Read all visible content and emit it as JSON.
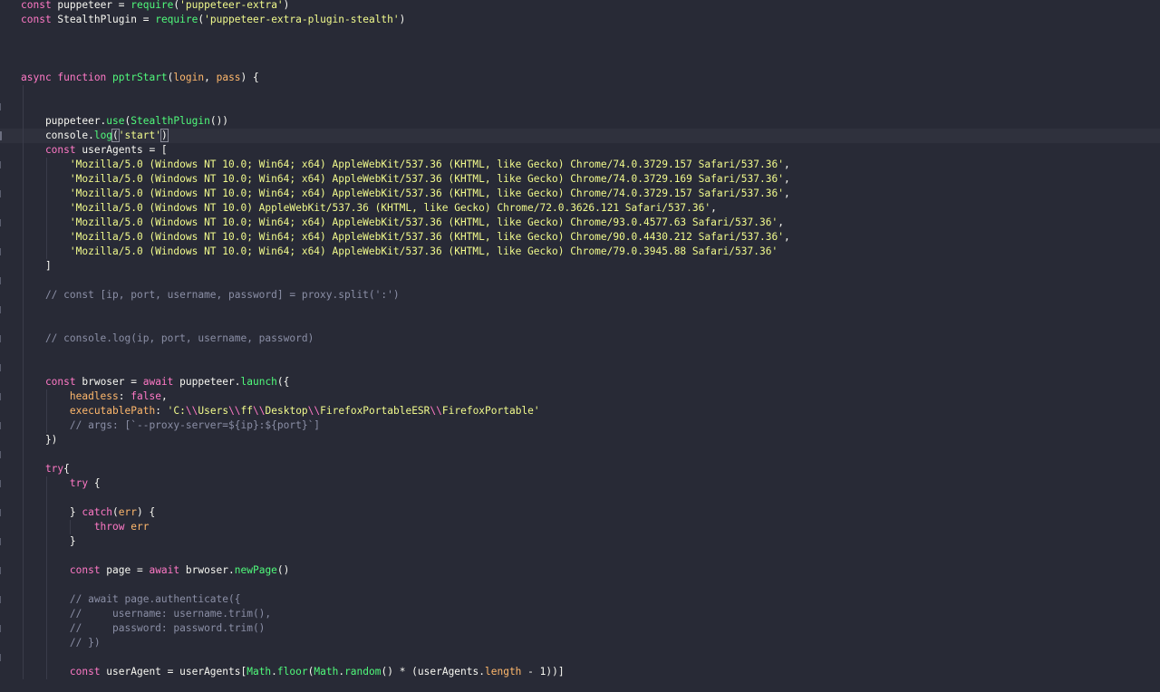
{
  "editor": {
    "theme_colors": {
      "background": "#282a36",
      "keyword": "#ff79c6",
      "function": "#50fa7b",
      "string": "#f1fa8c",
      "comment": "#8b8fa6",
      "property": "#ffb86c",
      "text": "#f8f8f2"
    },
    "lines": [
      [
        [
          "kw",
          "const "
        ],
        [
          "txt",
          "puppeteer = "
        ],
        [
          "fn",
          "require"
        ],
        [
          "txt",
          "("
        ],
        [
          "str",
          "'puppeteer-extra'"
        ],
        [
          "txt",
          ")"
        ]
      ],
      [
        [
          "kw",
          "const "
        ],
        [
          "txt",
          "StealthPlugin = "
        ],
        [
          "fn",
          "require"
        ],
        [
          "txt",
          "("
        ],
        [
          "str",
          "'puppeteer-extra-plugin-stealth'"
        ],
        [
          "txt",
          ")"
        ]
      ],
      [],
      [],
      [],
      [
        [
          "kw",
          "async function "
        ],
        [
          "fn",
          "pptrStart"
        ],
        [
          "txt",
          "("
        ],
        [
          "prop",
          "login"
        ],
        [
          "txt",
          ", "
        ],
        [
          "prop",
          "pass"
        ],
        [
          "txt",
          ") {"
        ]
      ],
      [],
      [],
      [
        [
          "txt",
          "    puppeteer."
        ],
        [
          "fn",
          "use"
        ],
        [
          "txt",
          "("
        ],
        [
          "fn",
          "StealthPlugin"
        ],
        [
          "txt",
          "())"
        ]
      ],
      [
        [
          "txt",
          "    console."
        ],
        [
          "fn",
          "log"
        ],
        [
          "brk",
          "("
        ],
        [
          "str",
          "'start'"
        ],
        [
          "brk",
          ")"
        ]
      ],
      [
        [
          "kw",
          "    const "
        ],
        [
          "txt",
          "userAgents = ["
        ]
      ],
      [
        [
          "str",
          "        'Mozilla/5.0 (Windows NT 10.0; Win64; x64) AppleWebKit/537.36 (KHTML, like Gecko) Chrome/74.0.3729.157 Safari/537.36'"
        ],
        [
          "txt",
          ","
        ]
      ],
      [
        [
          "str",
          "        'Mozilla/5.0 (Windows NT 10.0; Win64; x64) AppleWebKit/537.36 (KHTML, like Gecko) Chrome/74.0.3729.169 Safari/537.36'"
        ],
        [
          "txt",
          ","
        ]
      ],
      [
        [
          "str",
          "        'Mozilla/5.0 (Windows NT 10.0; Win64; x64) AppleWebKit/537.36 (KHTML, like Gecko) Chrome/74.0.3729.157 Safari/537.36'"
        ],
        [
          "txt",
          ","
        ]
      ],
      [
        [
          "str",
          "        'Mozilla/5.0 (Windows NT 10.0) AppleWebKit/537.36 (KHTML, like Gecko) Chrome/72.0.3626.121 Safari/537.36'"
        ],
        [
          "txt",
          ","
        ]
      ],
      [
        [
          "str",
          "        'Mozilla/5.0 (Windows NT 10.0; Win64; x64) AppleWebKit/537.36 (KHTML, like Gecko) Chrome/93.0.4577.63 Safari/537.36'"
        ],
        [
          "txt",
          ","
        ]
      ],
      [
        [
          "str",
          "        'Mozilla/5.0 (Windows NT 10.0; Win64; x64) AppleWebKit/537.36 (KHTML, like Gecko) Chrome/90.0.4430.212 Safari/537.36'"
        ],
        [
          "txt",
          ","
        ]
      ],
      [
        [
          "str",
          "        'Mozilla/5.0 (Windows NT 10.0; Win64; x64) AppleWebKit/537.36 (KHTML, like Gecko) Chrome/79.0.3945.88 Safari/537.36'"
        ]
      ],
      [
        [
          "txt",
          "    ]"
        ]
      ],
      [],
      [
        [
          "cm",
          "    // const [ip, port, username, password] = proxy.split(':')"
        ]
      ],
      [],
      [],
      [
        [
          "cm",
          "    // console.log(ip, port, username, password)"
        ]
      ],
      [],
      [],
      [
        [
          "kw",
          "    const "
        ],
        [
          "txt",
          "brwoser = "
        ],
        [
          "kw",
          "await "
        ],
        [
          "txt",
          "puppeteer."
        ],
        [
          "fn",
          "launch"
        ],
        [
          "txt",
          "({"
        ]
      ],
      [
        [
          "prop",
          "        headless"
        ],
        [
          "txt",
          ": "
        ],
        [
          "kw",
          "false"
        ],
        [
          "txt",
          ","
        ]
      ],
      [
        [
          "prop",
          "        executablePath"
        ],
        [
          "txt",
          ": "
        ],
        [
          "str",
          "'C:"
        ],
        [
          "esc",
          "\\\\"
        ],
        [
          "str",
          "Users"
        ],
        [
          "esc",
          "\\\\"
        ],
        [
          "str",
          "ff"
        ],
        [
          "esc",
          "\\\\"
        ],
        [
          "str",
          "Desktop"
        ],
        [
          "esc",
          "\\\\"
        ],
        [
          "str",
          "FirefoxPortableESR"
        ],
        [
          "esc",
          "\\\\"
        ],
        [
          "str",
          "FirefoxPortable'"
        ]
      ],
      [
        [
          "cm",
          "        // args: [`--proxy-server=${ip}:${port}`]"
        ]
      ],
      [
        [
          "txt",
          "    })"
        ]
      ],
      [],
      [
        [
          "kw",
          "    try"
        ],
        [
          "txt",
          "{"
        ]
      ],
      [
        [
          "kw",
          "        try "
        ],
        [
          "txt",
          "{"
        ]
      ],
      [],
      [
        [
          "txt",
          "        } "
        ],
        [
          "kw",
          "catch"
        ],
        [
          "txt",
          "("
        ],
        [
          "prop",
          "err"
        ],
        [
          "txt",
          ") {"
        ]
      ],
      [
        [
          "kw",
          "            throw "
        ],
        [
          "prop",
          "err"
        ]
      ],
      [
        [
          "txt",
          "        }"
        ]
      ],
      [],
      [
        [
          "kw",
          "        const "
        ],
        [
          "txt",
          "page = "
        ],
        [
          "kw",
          "await "
        ],
        [
          "txt",
          "brwoser."
        ],
        [
          "fn",
          "newPage"
        ],
        [
          "txt",
          "()"
        ]
      ],
      [],
      [
        [
          "cm",
          "        // await page.authenticate({"
        ]
      ],
      [
        [
          "cm",
          "        //     username: username.trim(),"
        ]
      ],
      [
        [
          "cm",
          "        //     password: password.trim()"
        ]
      ],
      [
        [
          "cm",
          "        // })"
        ]
      ],
      [],
      [
        [
          "kw",
          "        const "
        ],
        [
          "txt",
          "userAgent = userAgents["
        ],
        [
          "fn",
          "Math"
        ],
        [
          "txt",
          "."
        ],
        [
          "fn",
          "floor"
        ],
        [
          "txt",
          "("
        ],
        [
          "fn",
          "Math"
        ],
        [
          "txt",
          "."
        ],
        [
          "fn",
          "random"
        ],
        [
          "txt",
          "() * (userAgents."
        ],
        [
          "prop",
          "length"
        ],
        [
          "txt",
          " - 1))]"
        ]
      ]
    ]
  }
}
